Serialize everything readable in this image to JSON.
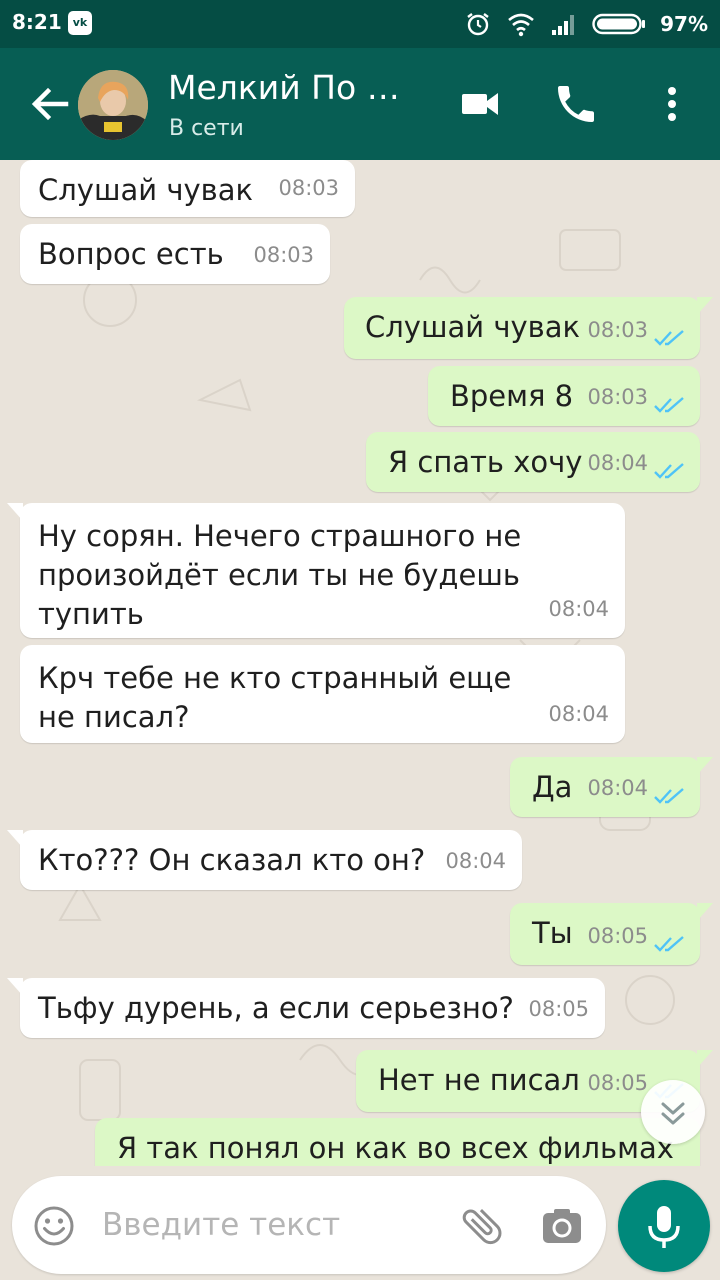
{
  "status_bar": {
    "time": "8:21",
    "vk_label": "vk",
    "battery": "97%"
  },
  "header": {
    "contact_name": "Мелкий По Ж…",
    "contact_status": "В сети"
  },
  "messages": [
    {
      "dir": "in",
      "text": "Слушай чувак",
      "time": "08:03"
    },
    {
      "dir": "in",
      "text": "Вопрос есть",
      "time": "08:03"
    },
    {
      "dir": "out",
      "text": "Слушай чувак",
      "time": "08:03",
      "read": true
    },
    {
      "dir": "out",
      "text": "Время 8",
      "time": "08:03",
      "read": true
    },
    {
      "dir": "out",
      "text": "Я спать хочу",
      "time": "08:04",
      "read": true
    },
    {
      "dir": "in",
      "text": "Ну сорян. Нечего страшного не произойдёт если ты не будешь тупить",
      "time": "08:04"
    },
    {
      "dir": "in",
      "text": "Крч тебе не кто странный еще не писал?",
      "time": "08:04"
    },
    {
      "dir": "out",
      "text": "Да",
      "time": "08:04",
      "read": true
    },
    {
      "dir": "in",
      "text": "Кто??? Он сказал кто он?",
      "time": "08:04"
    },
    {
      "dir": "out",
      "text": "Ты",
      "time": "08:05",
      "read": true
    },
    {
      "dir": "in",
      "text": "Тьфу дурень, а если серьезно?",
      "time": "08:05"
    },
    {
      "dir": "out",
      "text": "Нет не писал",
      "time": "08:05",
      "read": true
    },
    {
      "dir": "out",
      "text": "Я так понял он как во всех фильмах",
      "time": ""
    }
  ],
  "composer": {
    "placeholder": "Введите текст",
    "value": ""
  },
  "colors": {
    "header": "#075e54",
    "status_bar": "#054d44",
    "incoming": "#ffffff",
    "outgoing": "#dcf8c6",
    "read_ticks": "#4fc3f7",
    "mic": "#00897b"
  },
  "icons": {
    "back": "arrow-left-icon",
    "video": "video-call-icon",
    "call": "phone-icon",
    "menu": "more-vert-icon",
    "emoji": "emoji-icon",
    "attach": "paperclip-icon",
    "camera": "camera-icon",
    "mic": "microphone-icon",
    "scroll": "double-chevron-down-icon"
  }
}
